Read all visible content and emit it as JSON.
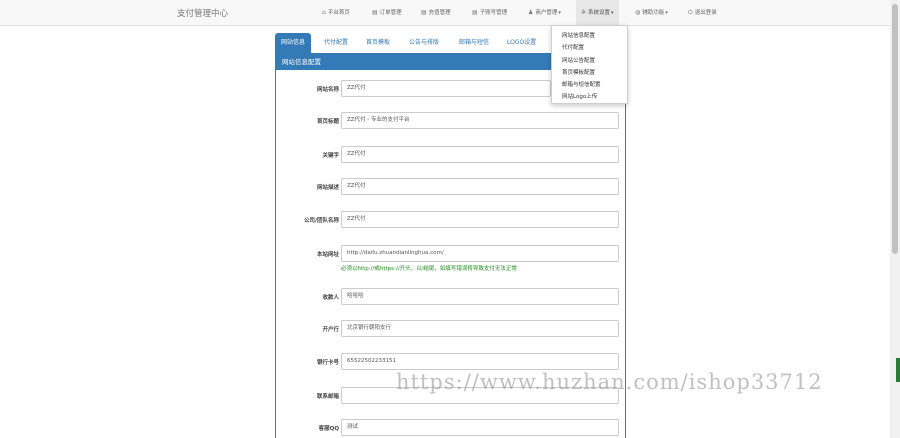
{
  "navbar": {
    "brand": "支付管理中心",
    "items": [
      {
        "icon": "home-icon",
        "glyph": "⌂",
        "label": "平台首页"
      },
      {
        "icon": "list-icon",
        "glyph": "▤",
        "label": "订单管理"
      },
      {
        "icon": "list-icon",
        "glyph": "▤",
        "label": "充值管理"
      },
      {
        "icon": "list-icon",
        "glyph": "▤",
        "label": "子账号管理"
      },
      {
        "icon": "user-icon",
        "glyph": "♟",
        "label": "商户管理"
      },
      {
        "icon": "gear-icon",
        "glyph": "✲",
        "label": "系统设置"
      },
      {
        "icon": "globe-icon",
        "glyph": "◍",
        "label": "辅助功能"
      },
      {
        "icon": "power-icon",
        "glyph": "⏻",
        "label": "退出登录"
      }
    ]
  },
  "dropdown": {
    "items": [
      "网站信息配置",
      "代付配置",
      "网站公告配置",
      "首页模板配置",
      "邮箱与短信配置",
      "网站Logo上传"
    ]
  },
  "tabs": [
    "网站信息",
    "代付配置",
    "首页模板",
    "公告与排版",
    "邮箱与短信",
    "LOGO设置"
  ],
  "panel": {
    "heading": "网站信息配置",
    "fields": [
      {
        "label": "网站名称",
        "value": "ZZ代付"
      },
      {
        "label": "首页标题",
        "value": "ZZ代付 - 专业的支付平台"
      },
      {
        "label": "关键字",
        "value": "ZZ代付"
      },
      {
        "label": "网站描述",
        "value": "ZZ代付"
      },
      {
        "label": "公司/团队名称",
        "value": "ZZ代付"
      },
      {
        "label": "本站网址",
        "value": "http://daifu.zhuandianlinghua.com/"
      },
      {
        "label": "收款人",
        "value": "哈哈哈"
      },
      {
        "label": "开户行",
        "value": "北京银行朝阳支行"
      },
      {
        "label": "银行卡号",
        "value": "65522502233151"
      },
      {
        "label": "联系邮箱",
        "value": ""
      },
      {
        "label": "客服QQ",
        "value": "测试"
      }
    ],
    "url_help": "必须以http://或https://开头，以/结尾，如填写错误将导致支付无法正常"
  },
  "watermark": "https://www.huzhan.com/ishop33712"
}
